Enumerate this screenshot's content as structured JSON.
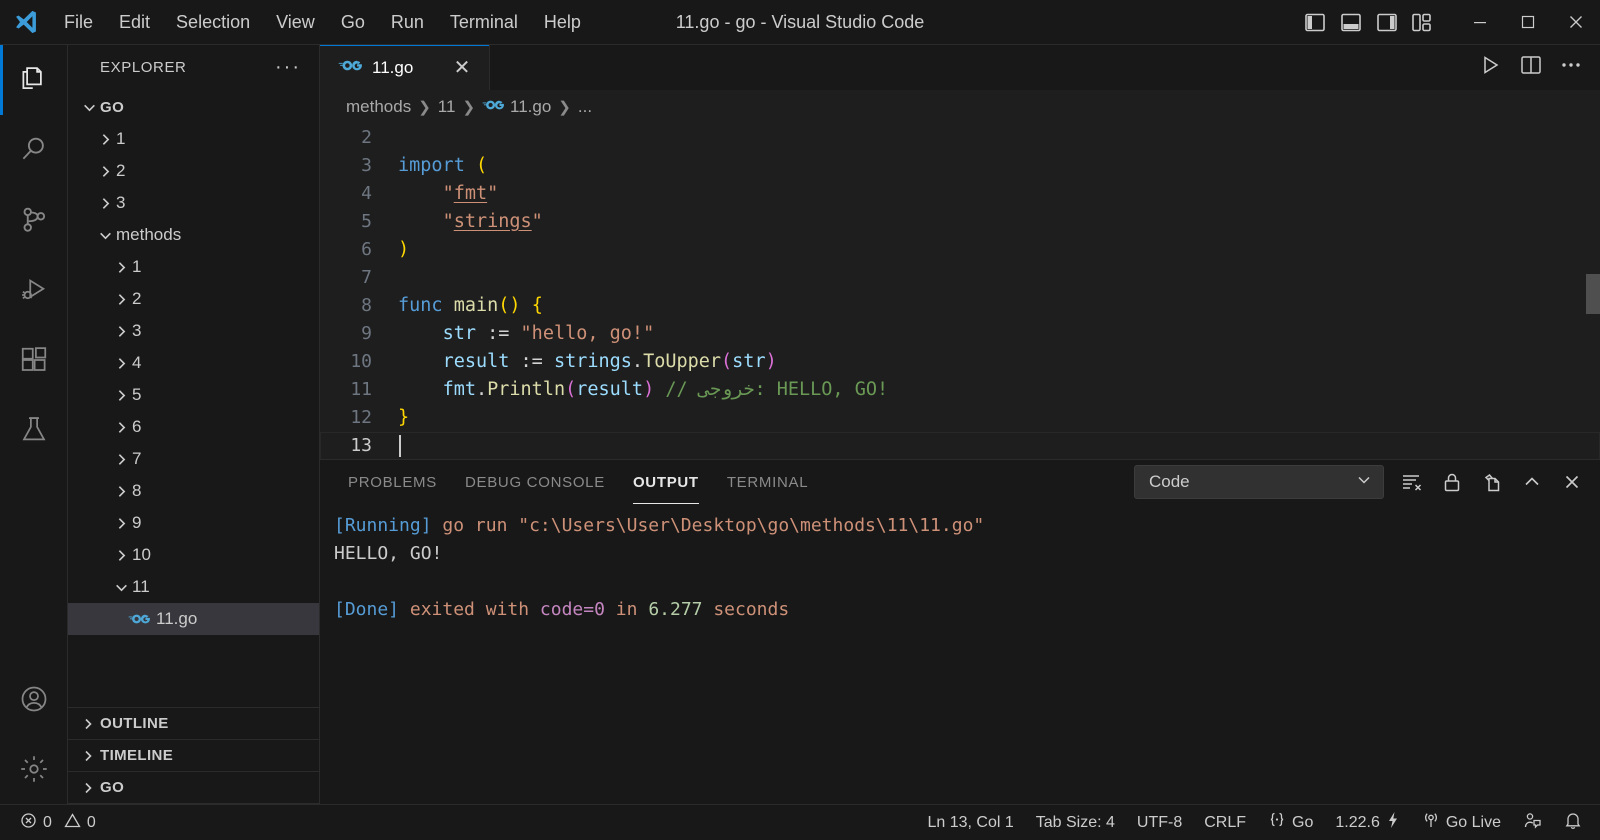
{
  "titlebar": {
    "window_title": "11.go - go - Visual Studio Code",
    "menus": [
      "File",
      "Edit",
      "Selection",
      "View",
      "Go",
      "Run",
      "Terminal",
      "Help"
    ],
    "layout_toggles": [
      "toggle-primary-sidebar",
      "toggle-panel",
      "toggle-secondary-sidebar",
      "customize-layout"
    ],
    "window_controls": {
      "minimize": "─",
      "maximize": "□",
      "close": "✕"
    }
  },
  "activitybar": {
    "items": [
      {
        "name": "explorer",
        "active": true
      },
      {
        "name": "search",
        "active": false
      },
      {
        "name": "source-control",
        "active": false
      },
      {
        "name": "run-and-debug",
        "active": false
      },
      {
        "name": "extensions",
        "active": false
      },
      {
        "name": "testing",
        "active": false
      }
    ],
    "bottom": [
      {
        "name": "accounts"
      },
      {
        "name": "manage-settings"
      }
    ]
  },
  "sidebar": {
    "header": "EXPLORER",
    "more_actions": "···",
    "tree": [
      {
        "label": "GO",
        "depth": 0,
        "type": "root",
        "expanded": true,
        "selected": false
      },
      {
        "label": "1",
        "depth": 1,
        "type": "folder",
        "expanded": false,
        "selected": false
      },
      {
        "label": "2",
        "depth": 1,
        "type": "folder",
        "expanded": false,
        "selected": false
      },
      {
        "label": "3",
        "depth": 1,
        "type": "folder",
        "expanded": false,
        "selected": false
      },
      {
        "label": "methods",
        "depth": 1,
        "type": "folder",
        "expanded": true,
        "selected": false
      },
      {
        "label": "1",
        "depth": 2,
        "type": "folder",
        "expanded": false,
        "selected": false
      },
      {
        "label": "2",
        "depth": 2,
        "type": "folder",
        "expanded": false,
        "selected": false
      },
      {
        "label": "3",
        "depth": 2,
        "type": "folder",
        "expanded": false,
        "selected": false
      },
      {
        "label": "4",
        "depth": 2,
        "type": "folder",
        "expanded": false,
        "selected": false
      },
      {
        "label": "5",
        "depth": 2,
        "type": "folder",
        "expanded": false,
        "selected": false
      },
      {
        "label": "6",
        "depth": 2,
        "type": "folder",
        "expanded": false,
        "selected": false
      },
      {
        "label": "7",
        "depth": 2,
        "type": "folder",
        "expanded": false,
        "selected": false
      },
      {
        "label": "8",
        "depth": 2,
        "type": "folder",
        "expanded": false,
        "selected": false
      },
      {
        "label": "9",
        "depth": 2,
        "type": "folder",
        "expanded": false,
        "selected": false
      },
      {
        "label": "10",
        "depth": 2,
        "type": "folder",
        "expanded": false,
        "selected": false
      },
      {
        "label": "11",
        "depth": 2,
        "type": "folder",
        "expanded": true,
        "selected": false
      },
      {
        "label": "11.go",
        "depth": 3,
        "type": "gofile",
        "expanded": false,
        "selected": true
      }
    ],
    "sections": [
      "OUTLINE",
      "TIMELINE",
      "GO"
    ]
  },
  "editor": {
    "tab": {
      "label": "11.go",
      "icon": "go-icon",
      "close": "✕"
    },
    "actions": [
      "run-code-button",
      "split-editor-button",
      "more-actions-button"
    ],
    "breadcrumb": [
      "methods",
      "11",
      "11.go",
      "..."
    ],
    "lines": [
      {
        "n": "2",
        "tokens": []
      },
      {
        "n": "3",
        "tokens": [
          {
            "t": "import",
            "c": "kw"
          },
          {
            "t": " ",
            "c": "pln"
          },
          {
            "t": "(",
            "c": "par1"
          }
        ]
      },
      {
        "n": "4",
        "tokens": [
          {
            "t": "    ",
            "c": "pln"
          },
          {
            "t": "\"",
            "c": "str"
          },
          {
            "t": "fmt",
            "c": "str-u"
          },
          {
            "t": "\"",
            "c": "str"
          }
        ]
      },
      {
        "n": "5",
        "tokens": [
          {
            "t": "    ",
            "c": "pln"
          },
          {
            "t": "\"",
            "c": "str"
          },
          {
            "t": "strings",
            "c": "str-u"
          },
          {
            "t": "\"",
            "c": "str"
          }
        ]
      },
      {
        "n": "6",
        "tokens": [
          {
            "t": ")",
            "c": "par1"
          }
        ]
      },
      {
        "n": "7",
        "tokens": []
      },
      {
        "n": "8",
        "tokens": [
          {
            "t": "func",
            "c": "kw"
          },
          {
            "t": " ",
            "c": "pln"
          },
          {
            "t": "main",
            "c": "fn"
          },
          {
            "t": "()",
            "c": "par1"
          },
          {
            "t": " ",
            "c": "pln"
          },
          {
            "t": "{",
            "c": "par1"
          }
        ]
      },
      {
        "n": "9",
        "tokens": [
          {
            "t": "    ",
            "c": "pln"
          },
          {
            "t": "str",
            "c": "var"
          },
          {
            "t": " := ",
            "c": "op"
          },
          {
            "t": "\"hello, go!\"",
            "c": "str"
          }
        ]
      },
      {
        "n": "10",
        "tokens": [
          {
            "t": "    ",
            "c": "pln"
          },
          {
            "t": "result",
            "c": "var"
          },
          {
            "t": " := ",
            "c": "op"
          },
          {
            "t": "strings",
            "c": "var"
          },
          {
            "t": ".",
            "c": "pln"
          },
          {
            "t": "ToUpper",
            "c": "fn"
          },
          {
            "t": "(",
            "c": "par2"
          },
          {
            "t": "str",
            "c": "var"
          },
          {
            "t": ")",
            "c": "par2"
          }
        ]
      },
      {
        "n": "11",
        "tokens": [
          {
            "t": "    ",
            "c": "pln"
          },
          {
            "t": "fmt",
            "c": "var"
          },
          {
            "t": ".",
            "c": "pln"
          },
          {
            "t": "Println",
            "c": "fn"
          },
          {
            "t": "(",
            "c": "par2"
          },
          {
            "t": "result",
            "c": "var"
          },
          {
            "t": ")",
            "c": "par2"
          },
          {
            "t": " ",
            "c": "pln"
          },
          {
            "t": "// خروجی: HELLO, GO!",
            "c": "cmt"
          }
        ]
      },
      {
        "n": "12",
        "tokens": [
          {
            "t": "}",
            "c": "par1"
          }
        ]
      },
      {
        "n": "13",
        "tokens": [],
        "caret": true
      }
    ]
  },
  "panel": {
    "tabs": [
      {
        "label": "PROBLEMS",
        "active": false
      },
      {
        "label": "DEBUG CONSOLE",
        "active": false
      },
      {
        "label": "OUTPUT",
        "active": true
      },
      {
        "label": "TERMINAL",
        "active": false
      }
    ],
    "channel": "Code",
    "channel_chevron": "⌄",
    "actions": [
      "clear-output-icon",
      "lock-icon",
      "open-in-editor-icon",
      "collapse-panel-icon",
      "close-panel-icon"
    ],
    "output": [
      [
        {
          "t": "[Running]",
          "c": "o-run"
        },
        {
          "t": " go run ",
          "c": "o-path"
        },
        {
          "t": "\"c:\\Users\\User\\Desktop\\go\\methods\\11\\11.go\"",
          "c": "o-path"
        }
      ],
      [
        {
          "t": "HELLO, GO!",
          "c": "o-plain"
        }
      ],
      [],
      [
        {
          "t": "[Done]",
          "c": "o-run"
        },
        {
          "t": " exited with ",
          "c": "o-path"
        },
        {
          "t": "code=0",
          "c": "o-code"
        },
        {
          "t": " in ",
          "c": "o-path"
        },
        {
          "t": "6.277",
          "c": "o-num"
        },
        {
          "t": " seconds",
          "c": "o-path"
        }
      ]
    ]
  },
  "statusbar": {
    "errors": "0",
    "warnings": "0",
    "cursor": "Ln 13, Col 1",
    "tab_size": "Tab Size: 4",
    "encoding": "UTF-8",
    "eol": "CRLF",
    "language": "Go",
    "version": "1.22.6",
    "go_live": "Go Live"
  }
}
